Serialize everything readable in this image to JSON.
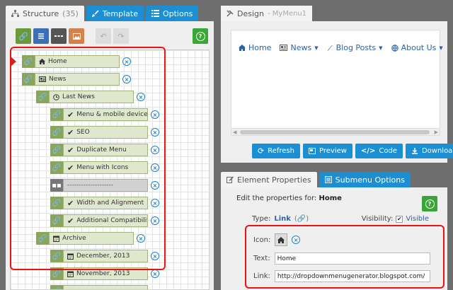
{
  "structure_panel": {
    "tabs": [
      {
        "label": "Structure",
        "count": "(35)"
      },
      {
        "label": "Template"
      },
      {
        "label": "Options"
      }
    ],
    "tree": [
      {
        "label": "Home",
        "icon": "home-icon"
      },
      {
        "label": "News",
        "icon": "news-icon"
      },
      {
        "label": "Last News",
        "icon": "clock-icon"
      },
      {
        "label": "Menu & mobile devices",
        "icon": "check-icon"
      },
      {
        "label": "SEO",
        "icon": "check-icon"
      },
      {
        "label": "Duplicate Menu",
        "icon": "check-icon"
      },
      {
        "label": "Menu with Icons",
        "icon": "check-icon"
      },
      {
        "label": "--------------------",
        "icon": "separator-icon"
      },
      {
        "label": "Width and Alignment",
        "icon": "check-icon"
      },
      {
        "label": "Additional Compatibility",
        "icon": "check-icon"
      },
      {
        "label": "Archive",
        "icon": "calendar-icon"
      },
      {
        "label": "December, 2013",
        "icon": "calendar-icon"
      },
      {
        "label": "November, 2013",
        "icon": "calendar-icon"
      }
    ]
  },
  "design_panel": {
    "tab_label": "Design",
    "tab_sub": "- MyMenu1",
    "menu": [
      {
        "label": "Home",
        "icon": "home-icon",
        "dropdown": false
      },
      {
        "label": "News",
        "icon": "news-icon",
        "dropdown": true
      },
      {
        "label": "Blog Posts",
        "icon": "pen-icon",
        "dropdown": true
      },
      {
        "label": "About Us",
        "icon": "globe-icon",
        "dropdown": true
      }
    ],
    "buttons": {
      "refresh": "Refresh",
      "preview": "Preview",
      "code": "Code",
      "download": "Download"
    }
  },
  "properties_panel": {
    "tabs": {
      "element": "Element Properties",
      "submenu": "Submenu Options"
    },
    "edit_prefix": "Edit the properties for:",
    "edit_target": "Home",
    "type_label": "Type:",
    "type_value": "Link",
    "visibility_label": "Visibility:",
    "visibility_value": "Visible",
    "icon_label": "Icon:",
    "text_label": "Text:",
    "text_value": "Home",
    "link_label": "Link:",
    "link_value": "http://dropdownmenugenerator.blogspot.com/"
  },
  "colors": {
    "accent_blue": "#1b8fd2",
    "tree_green": "#8aa65a",
    "highlight_red": "#e11111",
    "help_green": "#3aa637"
  }
}
